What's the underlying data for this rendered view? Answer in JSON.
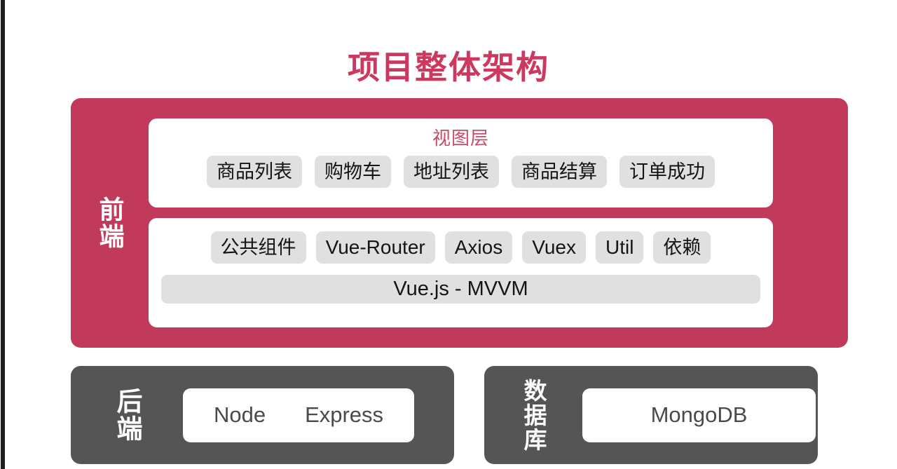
{
  "page": {
    "title": "项目整体架构",
    "accent_color": "#c23a5b",
    "title_color": "#cb3a5e",
    "dark_panel_color": "#555555",
    "chip_color": "#e0e0e0",
    "background": "#ffffff"
  },
  "frontend": {
    "label": "前端",
    "view_layer": {
      "title": "视图层",
      "items": [
        "商品列表",
        "购物车",
        "地址列表",
        "商品结算",
        "订单成功"
      ]
    },
    "framework_layer": {
      "items": [
        "公共组件",
        "Vue-Router",
        "Axios",
        "Vuex",
        "Util",
        "依赖"
      ],
      "core": "Vue.js - MVVM"
    }
  },
  "backend": {
    "label": "后端",
    "items": [
      "Node",
      "Express"
    ]
  },
  "database": {
    "label": "数据库",
    "items": [
      "MongoDB"
    ]
  }
}
